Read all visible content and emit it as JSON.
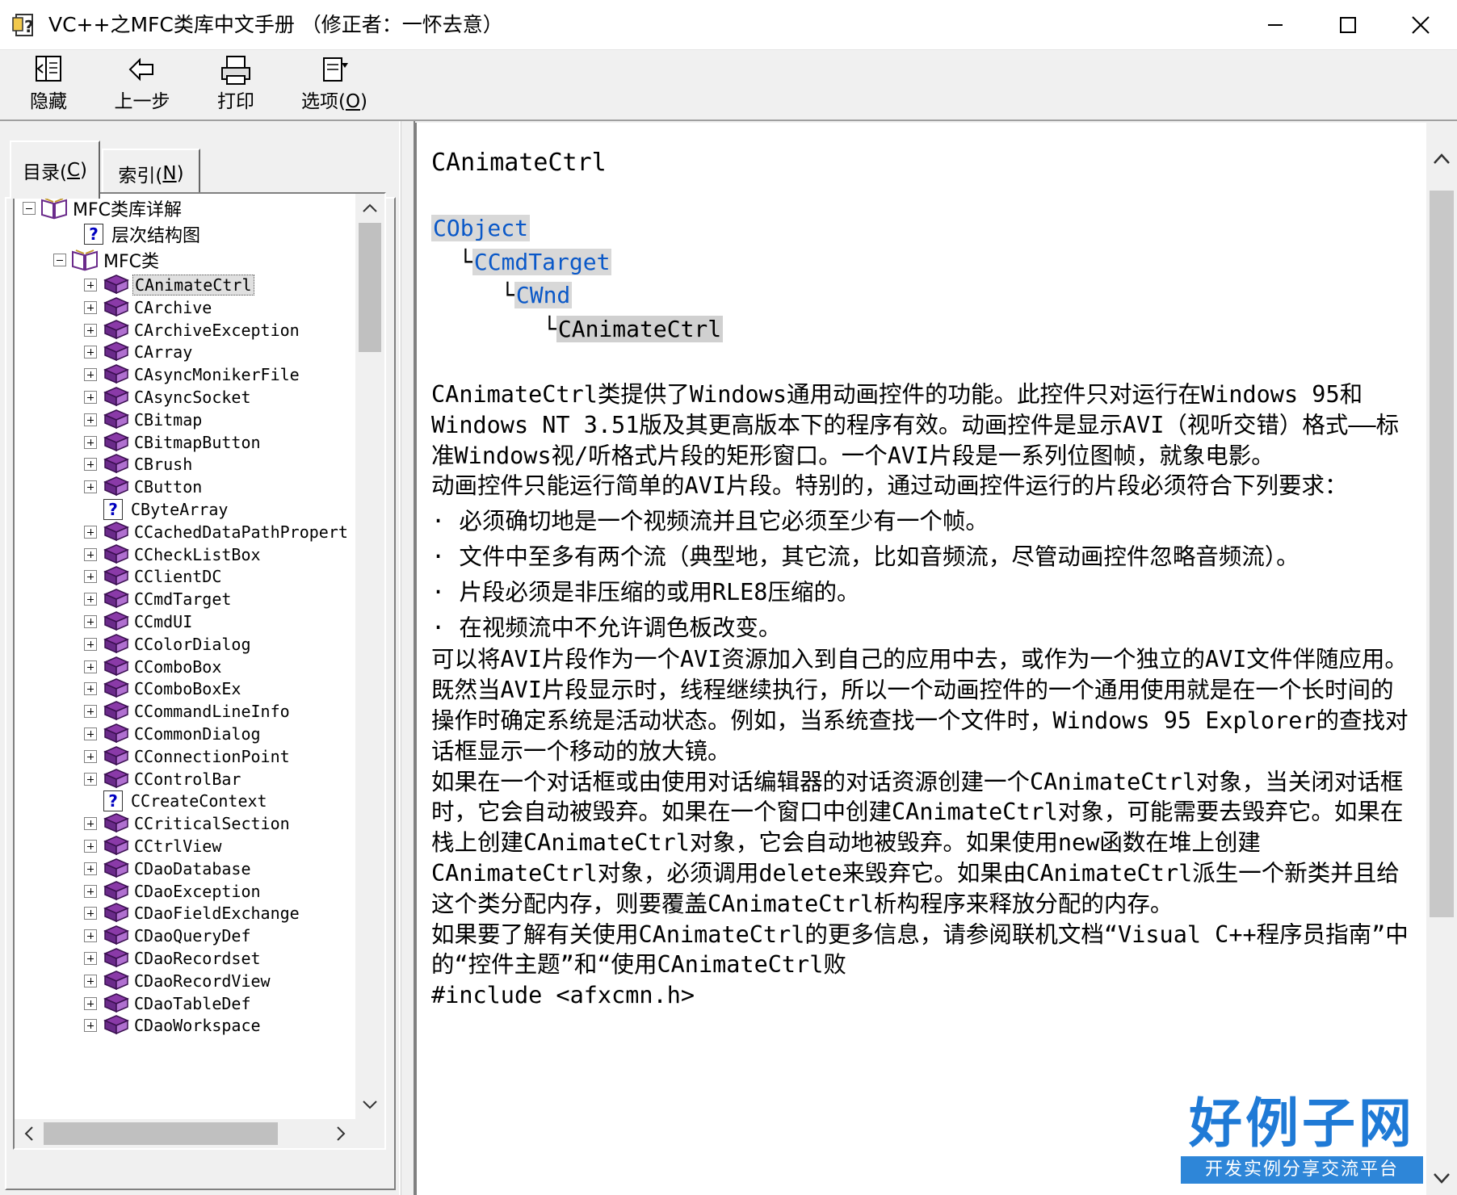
{
  "window": {
    "title": "VC++之MFC类库中文手册  （修正者：一怀去意）"
  },
  "toolbar": {
    "hide_label": "隐藏",
    "back_label": "上一步",
    "print_label": "打印",
    "options_label_main": "选项(",
    "options_label_key": "O",
    "options_label_end": ")"
  },
  "tabs": {
    "contents_main": "目录(",
    "contents_key": "C",
    "contents_end": ")",
    "index_main": "索引(",
    "index_key": "N",
    "index_end": ")"
  },
  "tree": {
    "root_label": "MFC类库详解",
    "hierarchy_label": "层次结构图",
    "mfc_classes_label": "MFC类",
    "items": [
      {
        "label": "CAnimateCtrl",
        "type": "book",
        "selected": true
      },
      {
        "label": "CArchive",
        "type": "book"
      },
      {
        "label": "CArchiveException",
        "type": "book"
      },
      {
        "label": "CArray",
        "type": "book"
      },
      {
        "label": "CAsyncMonikerFile",
        "type": "book"
      },
      {
        "label": "CAsyncSocket",
        "type": "book"
      },
      {
        "label": "CBitmap",
        "type": "book"
      },
      {
        "label": "CBitmapButton",
        "type": "book"
      },
      {
        "label": "CBrush",
        "type": "book"
      },
      {
        "label": "CButton",
        "type": "book"
      },
      {
        "label": "CByteArray",
        "type": "page"
      },
      {
        "label": "CCachedDataPathPropert",
        "type": "book"
      },
      {
        "label": "CCheckListBox",
        "type": "book"
      },
      {
        "label": "CClientDC",
        "type": "book"
      },
      {
        "label": "CCmdTarget",
        "type": "book"
      },
      {
        "label": "CCmdUI",
        "type": "book"
      },
      {
        "label": "CColorDialog",
        "type": "book"
      },
      {
        "label": "CComboBox",
        "type": "book"
      },
      {
        "label": "CComboBoxEx",
        "type": "book"
      },
      {
        "label": "CCommandLineInfo",
        "type": "book"
      },
      {
        "label": "CCommonDialog",
        "type": "book"
      },
      {
        "label": "CConnectionPoint",
        "type": "book"
      },
      {
        "label": "CControlBar",
        "type": "book"
      },
      {
        "label": "CCreateContext",
        "type": "page"
      },
      {
        "label": "CCriticalSection",
        "type": "book"
      },
      {
        "label": "CCtrlView",
        "type": "book"
      },
      {
        "label": "CDaoDatabase",
        "type": "book"
      },
      {
        "label": "CDaoException",
        "type": "book"
      },
      {
        "label": "CDaoFieldExchange",
        "type": "book"
      },
      {
        "label": "CDaoQueryDef",
        "type": "book"
      },
      {
        "label": "CDaoRecordset",
        "type": "book"
      },
      {
        "label": "CDaoRecordView",
        "type": "book"
      },
      {
        "label": "CDaoTableDef",
        "type": "book"
      },
      {
        "label": "CDaoWorkspace",
        "type": "book"
      }
    ]
  },
  "topic": {
    "title": "CAnimateCtrl",
    "hierarchy": {
      "level0": "CObject",
      "level1": "CCmdTarget",
      "level2": "CWnd",
      "level3": "CAnimateCtrl",
      "connector": "└"
    },
    "paragraphs": [
      "CAnimateCtrl类提供了Windows通用动画控件的功能。此控件只对运行在Windows 95和Windows NT 3.51版及其更高版本下的程序有效。动画控件是显示AVI（视听交错）格式——标准Windows视/听格式片段的矩形窗口。一个AVI片段是一系列位图帧，就象电影。",
      "动画控件只能运行简单的AVI片段。特别的，通过动画控件运行的片段必须符合下列要求："
    ],
    "bullets": [
      "· 必须确切地是一个视频流并且它必须至少有一个帧。",
      "· 文件中至多有两个流（典型地，其它流，比如音频流，尽管动画控件忽略音频流）。",
      "· 片段必须是非压缩的或用RLE8压缩的。",
      "· 在视频流中不允许调色板改变。"
    ],
    "paragraphs2": [
      "可以将AVI片段作为一个AVI资源加入到自己的应用中去，或作为一个独立的AVI文件伴随应用。",
      "既然当AVI片段显示时，线程继续执行，所以一个动画控件的一个通用使用就是在一个长时间的操作时确定系统是活动状态。例如，当系统查找一个文件时，Windows 95 Explorer的查找对话框显示一个移动的放大镜。",
      "如果在一个对话框或由使用对话编辑器的对话资源创建一个CAnimateCtrl对象，当关闭对话框时，它会自动被毁弃。如果在一个窗口中创建CAnimateCtrl对象，可能需要去毁弃它。如果在栈上创建CAnimateCtrl对象，它会自动地被毁弃。如果使用new函数在堆上创建CAnimateCtrl对象，必须调用delete来毁弃它。如果由CAnimateCtrl派生一个新类并且给这个类分配内存，则要覆盖CAnimateCtrl析构程序来释放分配的内存。",
      "如果要了解有关使用CAnimateCtrl的更多信息，请参阅联机文档“Visual C++程序员指南”中的“控件主题”和“使用CAnimateCtrl败",
      "#include <afxcmn.h>"
    ]
  },
  "watermark": {
    "brand": "好例子网",
    "tagline": "开发实例分享交流平台"
  },
  "colors": {
    "link": "#0a58c8",
    "book_purple": "#6a2a8a",
    "watermark_blue": "#1f7ad6"
  }
}
